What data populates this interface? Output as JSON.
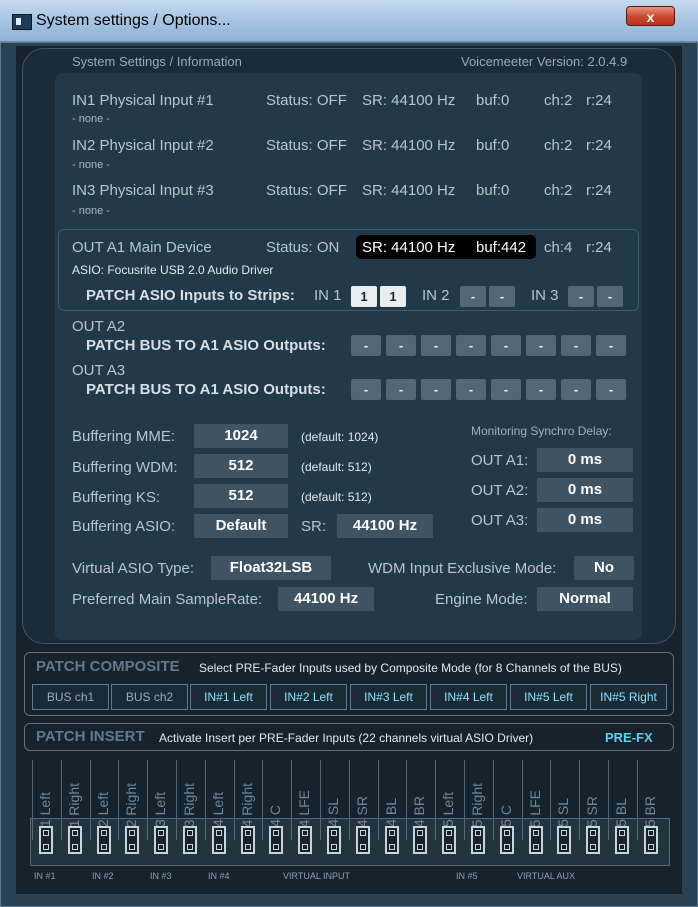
{
  "window": {
    "title": "System settings / Options...",
    "close_label": "x"
  },
  "header": {
    "left": "System Settings / Information",
    "right": "Voicemeeter Version: 2.0.4.9"
  },
  "inputs": [
    {
      "name": "IN1 Physical Input #1",
      "device": "- none -",
      "status": "Status: OFF",
      "sr": "SR: 44100 Hz",
      "buf": "buf:0",
      "ch": "ch:2",
      "r": "r:24"
    },
    {
      "name": "IN2 Physical Input #2",
      "device": "- none -",
      "status": "Status: OFF",
      "sr": "SR: 44100 Hz",
      "buf": "buf:0",
      "ch": "ch:2",
      "r": "r:24"
    },
    {
      "name": "IN3 Physical Input #3",
      "device": "- none -",
      "status": "Status: OFF",
      "sr": "SR: 44100 Hz",
      "buf": "buf:0",
      "ch": "ch:2",
      "r": "r:24"
    }
  ],
  "out_a1": {
    "name": "OUT A1 Main Device",
    "status": "Status: ON",
    "sr": "SR: 44100 Hz",
    "buf": "buf:442",
    "ch": "ch:4",
    "r": "r:24",
    "driver": "ASIO: Focusrite USB 2.0 Audio Driver",
    "patch_label": "PATCH ASIO Inputs to Strips:",
    "in1": "IN 1",
    "in2": "IN 2",
    "in3": "IN 3",
    "in1_a": "1",
    "in1_b": "1",
    "in2_a": "-",
    "in2_b": "-",
    "in3_a": "-",
    "in3_b": "-"
  },
  "out_a2": {
    "name": "OUT A2",
    "patch_label": "PATCH BUS TO A1 ASIO Outputs:",
    "slots": [
      "-",
      "-",
      "-",
      "-",
      "-",
      "-",
      "-",
      "-"
    ]
  },
  "out_a3": {
    "name": "OUT A3",
    "patch_label": "PATCH BUS TO A1 ASIO Outputs:",
    "slots": [
      "-",
      "-",
      "-",
      "-",
      "-",
      "-",
      "-",
      "-"
    ]
  },
  "buffering": {
    "mme_label": "Buffering MME:",
    "mme_value": "1024",
    "mme_default": "(default: 1024)",
    "wdm_label": "Buffering WDM:",
    "wdm_value": "512",
    "wdm_default": "(default: 512)",
    "ks_label": "Buffering KS:",
    "ks_value": "512",
    "ks_default": "(default: 512)",
    "asio_label": "Buffering ASIO:",
    "asio_value": "Default",
    "sr_label": "SR:",
    "sr_value": "44100 Hz"
  },
  "monitoring": {
    "title": "Monitoring Synchro Delay:",
    "a1_label": "OUT A1:",
    "a1_value": "0 ms",
    "a2_label": "OUT A2:",
    "a2_value": "0 ms",
    "a3_label": "OUT A3:",
    "a3_value": "0 ms"
  },
  "settings": {
    "vasio_label": "Virtual ASIO Type:",
    "vasio_value": "Float32LSB",
    "wdm_excl_label": "WDM Input Exclusive Mode:",
    "wdm_excl_value": "No",
    "pref_sr_label": "Preferred Main SampleRate:",
    "pref_sr_value": "44100 Hz",
    "engine_label": "Engine Mode:",
    "engine_value": "Normal"
  },
  "composite": {
    "title": "PATCH COMPOSITE",
    "desc": "Select PRE-Fader Inputs used by Composite Mode (for 8 Channels of the BUS)",
    "buttons": [
      "BUS ch1",
      "BUS ch2",
      "IN#1 Left",
      "IN#2 Left",
      "IN#3 Left",
      "IN#4 Left",
      "IN#5 Left",
      "IN#5 Right"
    ]
  },
  "insert": {
    "title": "PATCH INSERT",
    "desc": "Activate Insert per PRE-Fader Inputs (22 channels virtual ASIO Driver)",
    "prefx": "PRE-FX",
    "channels": [
      "in1 Left",
      "in1 Right",
      "in2 Left",
      "in2 Right",
      "in3 Left",
      "in3 Right",
      "in4 Left",
      "in4 Right",
      "in4 C",
      "in4 LFE",
      "in4 SL",
      "in4 SR",
      "in4 BL",
      "in4 BR",
      "in5 Left",
      "in5 Right",
      "in5 C",
      "in5 LFE",
      "in5 SL",
      "in5 SR",
      "in5 BL",
      "in5 BR"
    ],
    "groups": {
      "in1": "IN #1",
      "in2": "IN #2",
      "in3": "IN #3",
      "in4": "IN #4",
      "virtual_input": "VIRTUAL INPUT",
      "in5": "IN #5",
      "virtual_aux": "VIRTUAL AUX"
    }
  }
}
